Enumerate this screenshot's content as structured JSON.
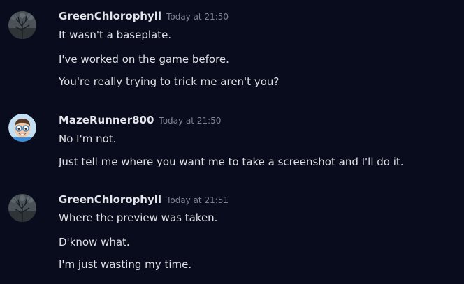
{
  "messages": [
    {
      "author": "GreenChlorophyll",
      "avatar_icon": "tree-avatar-icon",
      "timestamp": "Today at 21:50",
      "lines": [
        "It wasn't a baseplate.",
        "I've worked on the game before.",
        "You're really trying to trick me aren't you?"
      ]
    },
    {
      "author": "MazeRunner800",
      "avatar_icon": "cartoon-face-avatar-icon",
      "timestamp": "Today at 21:50",
      "lines": [
        "No I'm not.",
        "Just tell me where you want me to take a screenshot and I'll do it."
      ]
    },
    {
      "author": "GreenChlorophyll",
      "avatar_icon": "tree-avatar-icon",
      "timestamp": "Today at 21:51",
      "lines": [
        "Where the preview was taken.",
        "D'know what.",
        "I'm just wasting my time."
      ]
    }
  ],
  "colors": {
    "background": "#080c1c",
    "username": "#e4e6ec",
    "timestamp": "#7e8494",
    "message_text": "#dfe1e6"
  }
}
